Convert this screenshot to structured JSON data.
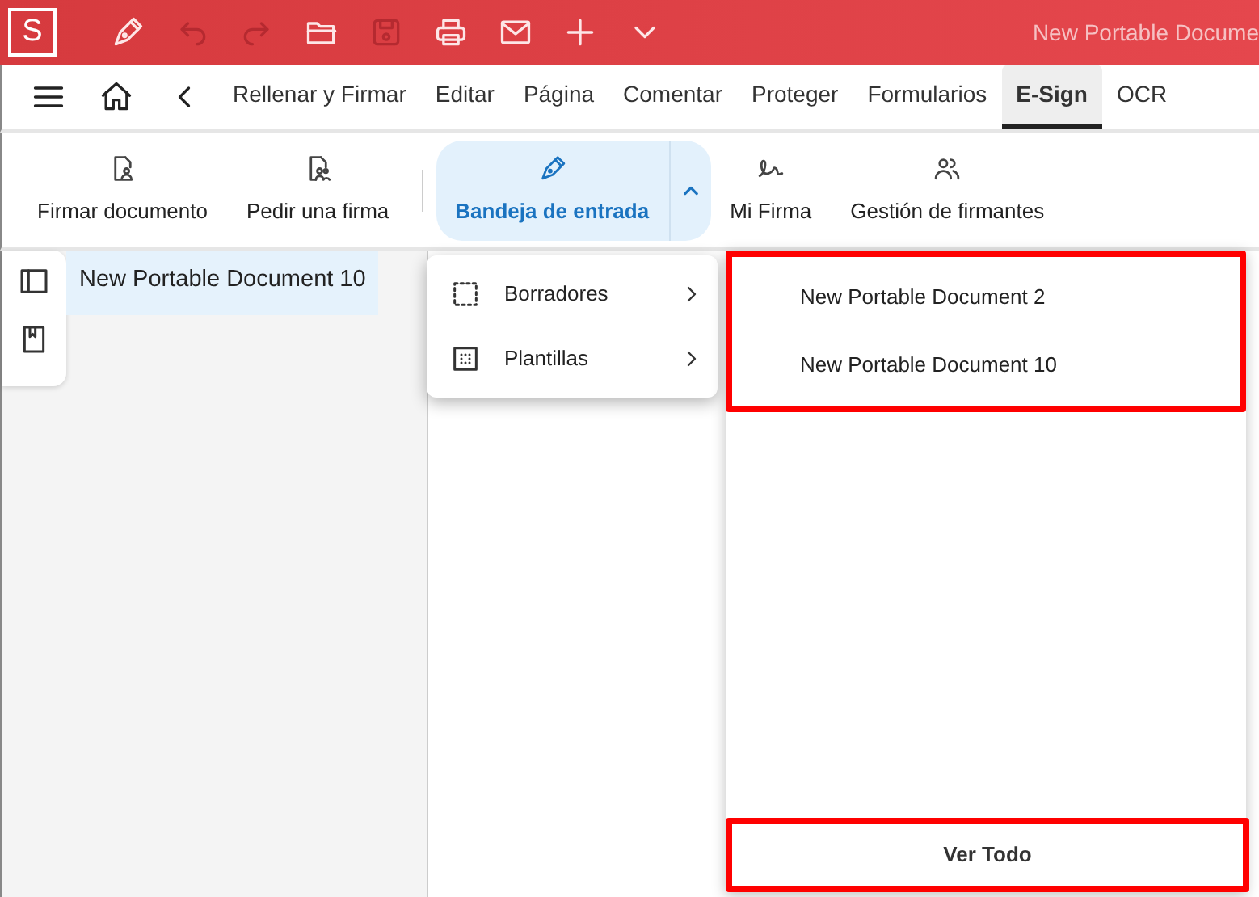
{
  "title_bar": {
    "logo": "S",
    "tools": [
      {
        "kind": "pen",
        "disabled": false
      },
      {
        "kind": "undo",
        "disabled": true
      },
      {
        "kind": "redo",
        "disabled": true
      },
      {
        "kind": "folder",
        "disabled": false
      },
      {
        "kind": "save",
        "disabled": true
      },
      {
        "kind": "print",
        "disabled": false
      },
      {
        "kind": "mail",
        "disabled": false
      },
      {
        "kind": "plus",
        "disabled": false
      },
      {
        "kind": "chevron",
        "disabled": false
      }
    ],
    "title": "New Portable Docume"
  },
  "tabs": [
    {
      "label": "Rellenar y Firmar",
      "selected": false
    },
    {
      "label": "Editar",
      "selected": false
    },
    {
      "label": "Página",
      "selected": false
    },
    {
      "label": "Comentar",
      "selected": false
    },
    {
      "label": "Proteger",
      "selected": false
    },
    {
      "label": "Formularios",
      "selected": false
    },
    {
      "label": "E-Sign",
      "selected": true
    },
    {
      "label": "OCR",
      "selected": false
    }
  ],
  "ribbon": [
    {
      "label": "Firmar documento",
      "kind": "sign",
      "selected": false,
      "split": false
    },
    {
      "label": "Pedir una firma",
      "kind": "request",
      "selected": false,
      "split": false
    },
    {
      "label": "Bandeja de entrada",
      "kind": "inbox",
      "selected": true,
      "split": true
    },
    {
      "label": "Mi Firma",
      "kind": "signature",
      "selected": false,
      "split": false
    },
    {
      "label": "Gestión de firmantes",
      "kind": "people",
      "selected": false,
      "split": false
    }
  ],
  "side_rail": [
    {
      "kind": "panel"
    },
    {
      "kind": "bookmark"
    }
  ],
  "document_tabs": [
    {
      "label": "New Portable Document 10",
      "selected": true
    }
  ],
  "inbox_menu": [
    {
      "label": "Borradores",
      "kind": "drafts"
    },
    {
      "label": "Plantillas",
      "kind": "templates"
    }
  ],
  "document_list": {
    "highlighted": true,
    "items": [
      "New Portable Document 2",
      "New Portable Document 10"
    ],
    "footer": {
      "label": "Ver Todo",
      "highlighted": true
    }
  }
}
